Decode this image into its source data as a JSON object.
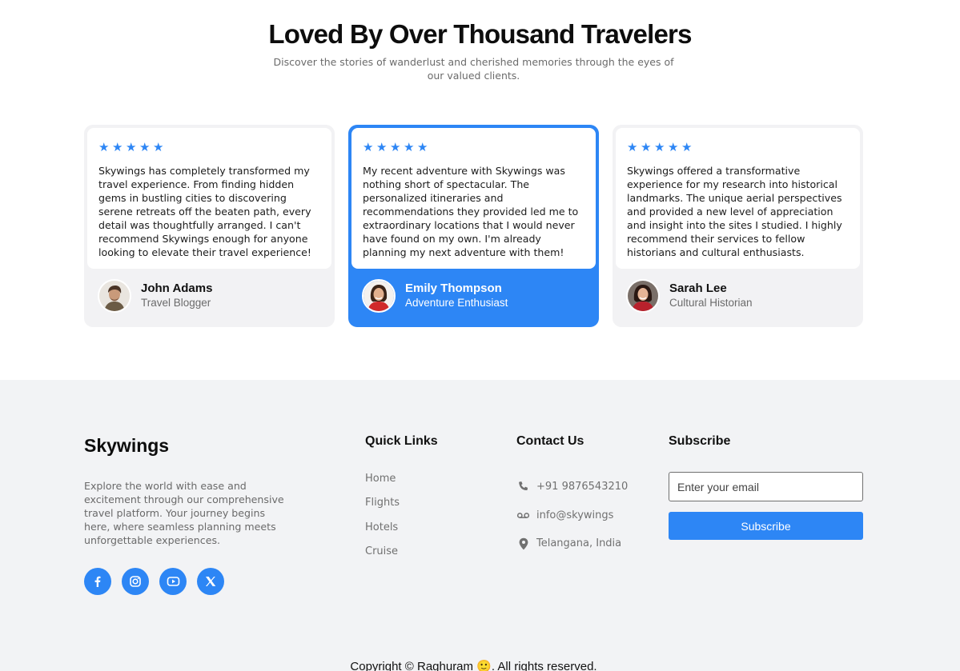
{
  "testimonials": {
    "title": "Loved By Over Thousand Travelers",
    "subtitle": "Discover the stories of wanderlust and cherished memories through the eyes of our valued clients.",
    "star_icon": "star-icon",
    "cards": [
      {
        "rating": 5,
        "quote": "Skywings has completely transformed my travel experience. From finding hidden gems in bustling cities to discovering serene retreats off the beaten path, every detail was thoughtfully arranged. I can't recommend Skywings enough for anyone looking to elevate their travel experience!",
        "name": "John Adams",
        "role": "Travel Blogger"
      },
      {
        "rating": 5,
        "quote": "My recent adventure with Skywings was nothing short of spectacular. The personalized itineraries and recommendations they provided led me to extraordinary locations that I would never have found on my own. I'm already planning my next adventure with them!",
        "name": "Emily Thompson",
        "role": "Adventure Enthusiast"
      },
      {
        "rating": 5,
        "quote": "Skywings offered a transformative experience for my research into historical landmarks. The unique aerial perspectives and provided a new level of appreciation and insight into the sites I studied. I highly recommend their services to fellow historians and cultural enthusiasts.",
        "name": "Sarah Lee",
        "role": "Cultural Historian"
      }
    ]
  },
  "footer": {
    "brand": "Skywings",
    "about": "Explore the world with ease and excitement through our comprehensive travel platform. Your journey begins here, where seamless planning meets unforgettable experiences.",
    "socials": [
      "facebook-icon",
      "instagram-icon",
      "youtube-icon",
      "x-icon"
    ],
    "quick_links": {
      "title": "Quick Links",
      "items": [
        "Home",
        "Flights",
        "Hotels",
        "Cruise"
      ]
    },
    "contact": {
      "title": "Contact Us",
      "phone": "+91 9876543210",
      "email": "info@skywings",
      "location": "Telangana, India"
    },
    "subscribe": {
      "title": "Subscribe",
      "placeholder": "Enter your email",
      "button": "Subscribe"
    },
    "copyright": "Copyright © Raghuram 🙂. All rights reserved."
  },
  "colors": {
    "accent": "#2d86f5",
    "footer_bg": "#f2f3f5",
    "card_bg": "#f2f2f4"
  }
}
